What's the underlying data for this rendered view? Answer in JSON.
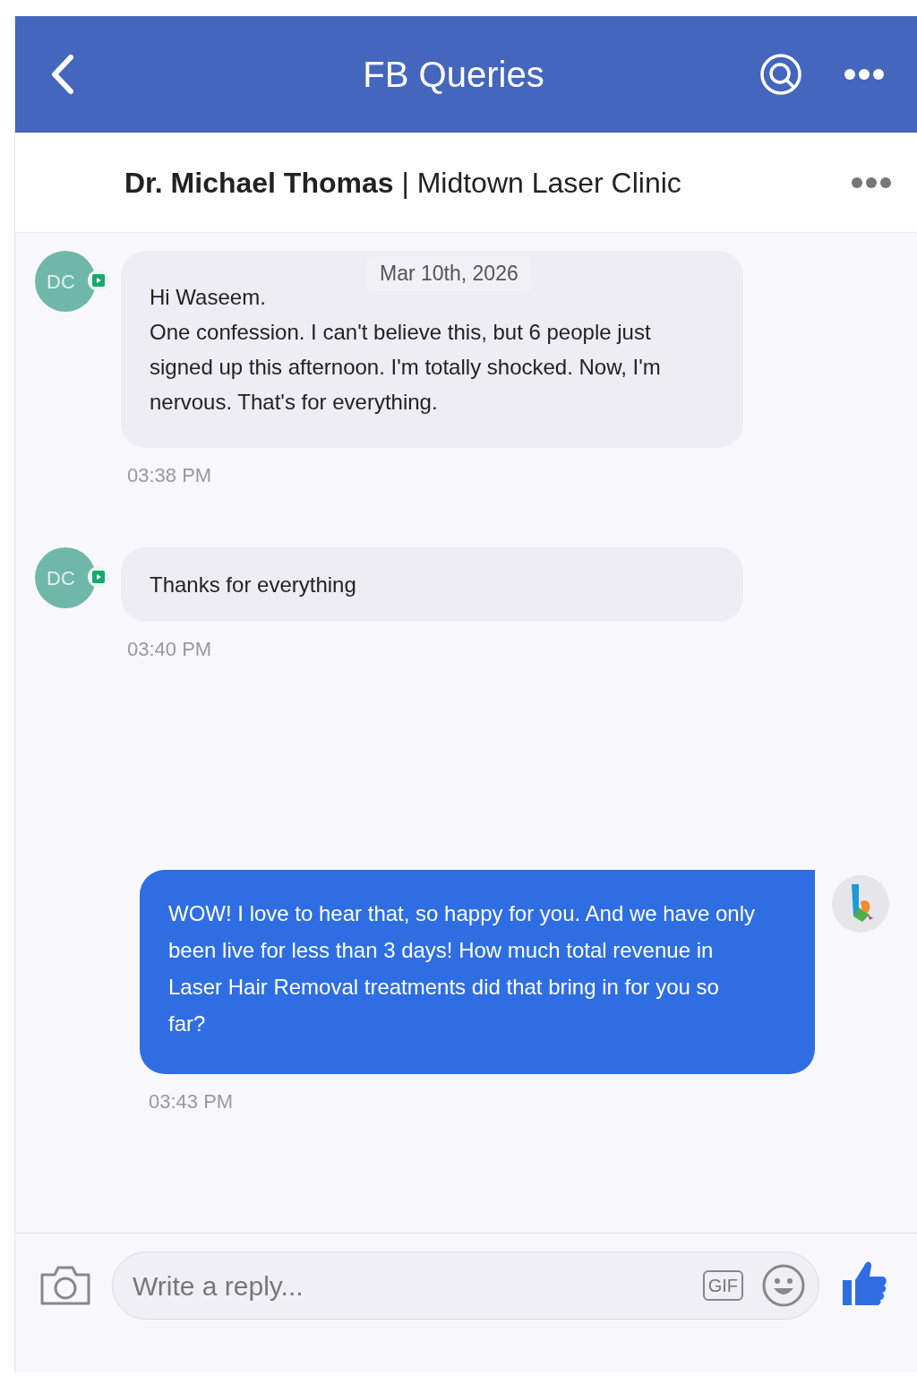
{
  "header": {
    "title": "FB Queries"
  },
  "contact": {
    "name": "Dr. Michael Thomas",
    "separator": "|",
    "organization": "Midtown Laser Clinic"
  },
  "messages": [
    {
      "kind": "incoming",
      "avatar": "DC",
      "date": "Mar 10th, 2026",
      "text": "Hi Waseem.\nOne confession. I can't believe this, but 6 people just signed up this afternoon. I'm totally shocked. Now, I'm nervous. That's for everything.",
      "time": "03:38 PM"
    },
    {
      "kind": "incoming",
      "avatar": "DC",
      "text": "Thanks for everything",
      "time": "03:40 PM"
    },
    {
      "kind": "outgoing",
      "text": "WOW! I love to hear that, so happy for you. And we have only been live for less than 3 days! How much total revenue in Laser Hair Removal treatments did that bring in for you so far?",
      "time": "03:43 PM"
    }
  ],
  "composer": {
    "placeholder": "Write a reply...",
    "gif_label": "GIF"
  }
}
